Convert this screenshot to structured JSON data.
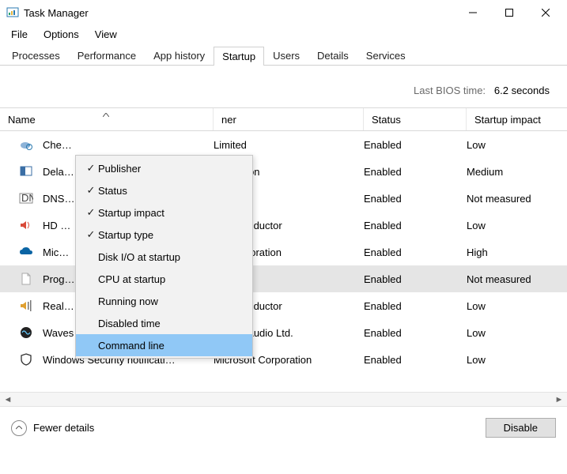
{
  "window": {
    "title": "Task Manager"
  },
  "menubar": {
    "items": [
      "File",
      "Options",
      "View"
    ]
  },
  "tabs": {
    "items": [
      "Processes",
      "Performance",
      "App history",
      "Startup",
      "Users",
      "Details",
      "Services"
    ],
    "active_index": 3
  },
  "bios": {
    "label": "Last BIOS time:",
    "value": "6.2 seconds"
  },
  "columns": {
    "name": "Name",
    "publisher": "Publisher",
    "status": "Status",
    "impact": "Startup impact",
    "pub_header_visible": "ner"
  },
  "rows": [
    {
      "icon": "cloud-sync",
      "name": "Che…",
      "publisher": "Limited",
      "status": "Enabled",
      "impact": "Low",
      "selected": false
    },
    {
      "icon": "panel",
      "name": "Dela…",
      "publisher": "orporation",
      "status": "Enabled",
      "impact": "Medium",
      "selected": false
    },
    {
      "icon": "dns",
      "name": "DNS…",
      "publisher": "it",
      "status": "Enabled",
      "impact": "Not measured",
      "selected": false
    },
    {
      "icon": "speaker-red",
      "name": "HD …",
      "publisher": "Semiconductor",
      "status": "Enabled",
      "impact": "Low",
      "selected": false
    },
    {
      "icon": "onedrive",
      "name": "Mic…",
      "publisher": "oft Corporation",
      "status": "Enabled",
      "impact": "High",
      "selected": false
    },
    {
      "icon": "file",
      "name": "Prog…",
      "publisher": "",
      "status": "Enabled",
      "impact": "Not measured",
      "selected": true
    },
    {
      "icon": "speaker-bars",
      "name": "Real…",
      "publisher": "Semiconductor",
      "status": "Enabled",
      "impact": "Low",
      "selected": false
    },
    {
      "icon": "waves",
      "name": "Waves MaxxAudio Service A…",
      "publisher": "Waves Audio Ltd.",
      "status": "Enabled",
      "impact": "Low",
      "selected": false
    },
    {
      "icon": "shield",
      "name": "Windows Security notificati…",
      "publisher": "Microsoft Corporation",
      "status": "Enabled",
      "impact": "Low",
      "selected": false
    }
  ],
  "context_menu": {
    "items": [
      {
        "label": "Publisher",
        "checked": true
      },
      {
        "label": "Status",
        "checked": true
      },
      {
        "label": "Startup impact",
        "checked": true
      },
      {
        "label": "Startup type",
        "checked": true
      },
      {
        "label": "Disk I/O at startup",
        "checked": false
      },
      {
        "label": "CPU at startup",
        "checked": false
      },
      {
        "label": "Running now",
        "checked": false
      },
      {
        "label": "Disabled time",
        "checked": false
      },
      {
        "label": "Command line",
        "checked": false,
        "highlighted": true
      }
    ]
  },
  "footer": {
    "fewer": "Fewer details",
    "disable": "Disable"
  }
}
